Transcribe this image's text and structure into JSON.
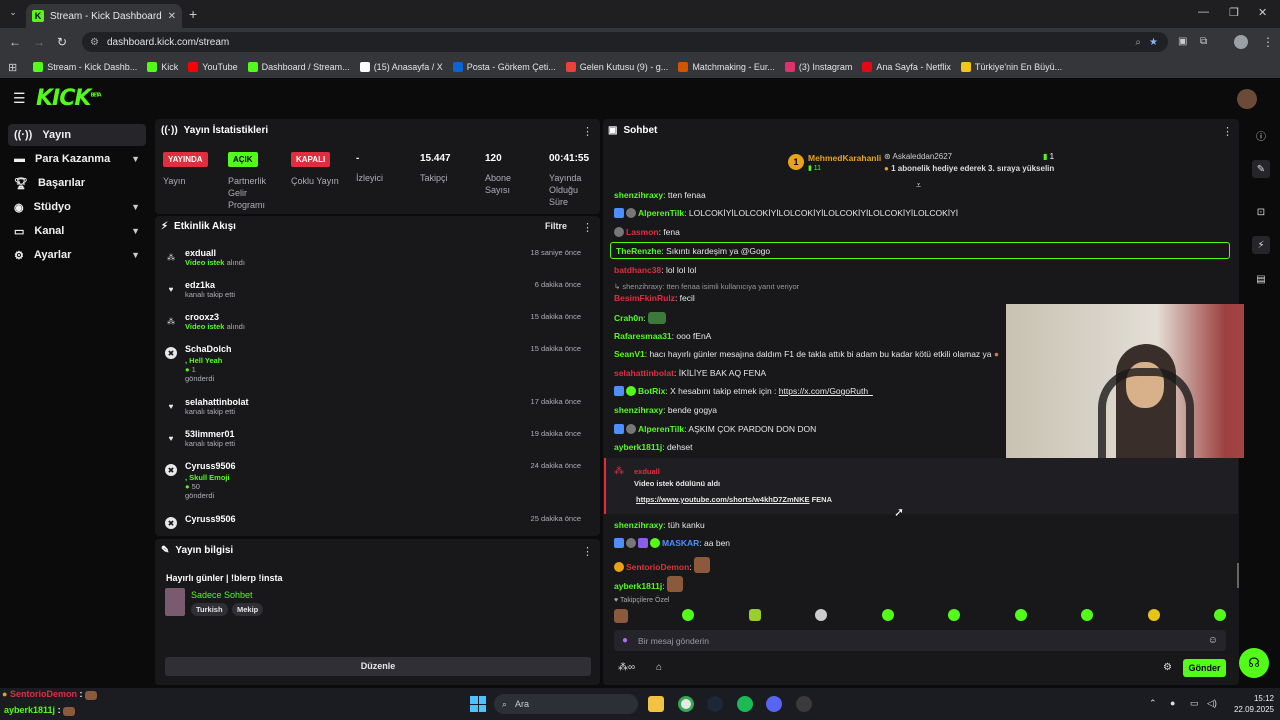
{
  "browser": {
    "tab_title": "Stream - Kick Dashboard",
    "url": "dashboard.kick.com/stream",
    "bookmarks": [
      "Stream - Kick Dashb...",
      "Kick",
      "YouTube",
      "Dashboard / Stream...",
      "(15) Anasayfa / X",
      "Posta - Görkem Çeti...",
      "Gelen Kutusu (9) - g...",
      "Matchmaking - Eur...",
      "(3) Instagram",
      "Ana Sayfa - Netflix",
      "Türkiye'nin En Büyü..."
    ]
  },
  "header": {
    "logo": "KICK",
    "logo_sup": "BETA"
  },
  "sidebar": {
    "items": [
      {
        "label": "Yayın"
      },
      {
        "label": "Para Kazanma"
      },
      {
        "label": "Başarılar"
      },
      {
        "label": "Stüdyo"
      },
      {
        "label": "Kanal"
      },
      {
        "label": "Ayarlar"
      }
    ]
  },
  "stats": {
    "title": "Yayın İstatistikleri",
    "cols": [
      {
        "badge": "YAYINDA",
        "label": "Yayın"
      },
      {
        "badge": "AÇIK",
        "label": "Partnerlik Gelir Programı"
      },
      {
        "badge": "KAPALI",
        "label": "Çoklu Yayın"
      },
      {
        "value": "-",
        "label": "İzleyici"
      },
      {
        "value": "15.447",
        "label": "Takipçi"
      },
      {
        "value": "120",
        "label": "Abone Sayısı"
      },
      {
        "value": "00:41:55",
        "label": "Yayında Olduğu Süre"
      }
    ]
  },
  "activity": {
    "title": "Etkinlik Akışı",
    "filter": "Filtre",
    "events": [
      {
        "name": "exduall",
        "action": "Video istek",
        "suffix": "alındı",
        "time": "18 saniye önce"
      },
      {
        "name": "edz1ka",
        "action": "",
        "suffix": "kanalı takip etti",
        "time": "6 dakika önce"
      },
      {
        "name": "crooxz3",
        "action": "Video istek",
        "suffix": "alındı",
        "time": "15 dakika önce"
      },
      {
        "name": "SchaDolch",
        "action": ", Hell Yeah",
        "suffix": "1",
        "extra": "gönderdi",
        "time": "15 dakika önce"
      },
      {
        "name": "selahattinbolat",
        "action": "",
        "suffix": "kanalı takip etti",
        "time": "17 dakika önce"
      },
      {
        "name": "53limmer01",
        "action": "",
        "suffix": "kanalı takip etti",
        "time": "19 dakika önce"
      },
      {
        "name": "Cyruss9506",
        "action": ", Skull Emoji",
        "suffix": "50",
        "extra": "gönderdi",
        "time": "24 dakika önce"
      },
      {
        "name": "Cyruss9506",
        "action": "",
        "suffix": "",
        "time": "25 dakika önce"
      }
    ]
  },
  "info": {
    "title": "Yayın bilgisi",
    "stream_title": "Hayırlı günler | !blerp !insta",
    "category": "Sadece Sohbet",
    "tags": [
      "Turkish",
      "Mekip"
    ],
    "edit": "Düzenle"
  },
  "chat": {
    "title": "Sohbet",
    "pinned_user1": "MehmedKarahanli",
    "pinned_count1": "11",
    "pinned_user2": "Askaleddan2627",
    "pinned_count2": "1",
    "pinned_text": "1 abonelik hediye ederek 3. sıraya yükselin",
    "messages": [
      {
        "user": "shenzihraxy",
        "text": ": tten fenaa",
        "color": "#53fc18"
      },
      {
        "user": "AlperenTilk",
        "text": ": LOLCOKİYİLOLCOKİYİLOLCOKİYİLOLCOKİYİLOLCOKİYİLOLCOKİYİ",
        "color": "#53fc18"
      },
      {
        "user": "Lasmon",
        "text": ": fena",
        "color": "#e02e3e"
      },
      {
        "user": "TheRenzhe",
        "text": ": Sıkıntı kardeşim ya @Gogo",
        "color": "#53fc18"
      },
      {
        "user": "batdhanc38",
        "text": ": lol lol lol",
        "color": "#e02e3e"
      },
      {
        "reply": "shenzihraxy: tten fenaa isimli kullanıcıya yanıt veriyor"
      },
      {
        "user": "BesimFkinRulz",
        "text": ": fecil",
        "color": "#e02e3e"
      },
      {
        "user": "Crah0n",
        "text": ":",
        "color": "#53fc18"
      },
      {
        "user": "Rafaresmaa31",
        "text": ": ooo fEnA",
        "color": "#53fc18"
      },
      {
        "user": "SeanV1",
        "text": ": hacı hayırlı günler mesajına daldım F1 de takla attık bi adam bu kadar kötü etkili olamaz ya",
        "color": "#53fc18"
      },
      {
        "user": "selahattinbolat",
        "text": ": İKİLİYE BAK AQ FENA",
        "color": "#e02e3e"
      },
      {
        "user": "BotRix",
        "text": ": X hesabını takip etmek için : ",
        "link": "https://x.com/GogoRuth_",
        "color": "#53fc18"
      },
      {
        "user": "shenzihraxy",
        "text": ": bende gogya",
        "color": "#53fc18"
      },
      {
        "user": "AlperenTilk",
        "text": ": AŞKIM ÇOK PARDON DON DON",
        "color": "#53fc18"
      },
      {
        "user": "ayberk1811j",
        "text": ": dehset",
        "color": "#53fc18"
      }
    ],
    "reward_user": "exduall",
    "reward_text": "Video istek ödülünü aldı",
    "reward_link": "https://www.youtube.com/shorts/w4khD7ZmNKE",
    "reward_suffix": " FENA",
    "messages2": [
      {
        "user": "shenzihraxy",
        "text": ": tüh kanku",
        "color": "#53fc18"
      },
      {
        "user": "MASKAR",
        "text": ": aa ben",
        "color": "#4e8fff"
      },
      {
        "user": "SentorioDemon",
        "text": ":",
        "color": "#e02e3e"
      },
      {
        "user": "ayberk1811j",
        "text": ":",
        "color": "#53fc18"
      }
    ],
    "followers_only": "Takipçilere Özel",
    "placeholder": "Bir mesaj gönderin",
    "send": "Gönder"
  },
  "overlay": {
    "line1_user": "SentorioDemon",
    "line2_user": "ayberk1811j"
  },
  "taskbar": {
    "search": "Ara",
    "time": "15:12",
    "date": "22.09.2025"
  }
}
